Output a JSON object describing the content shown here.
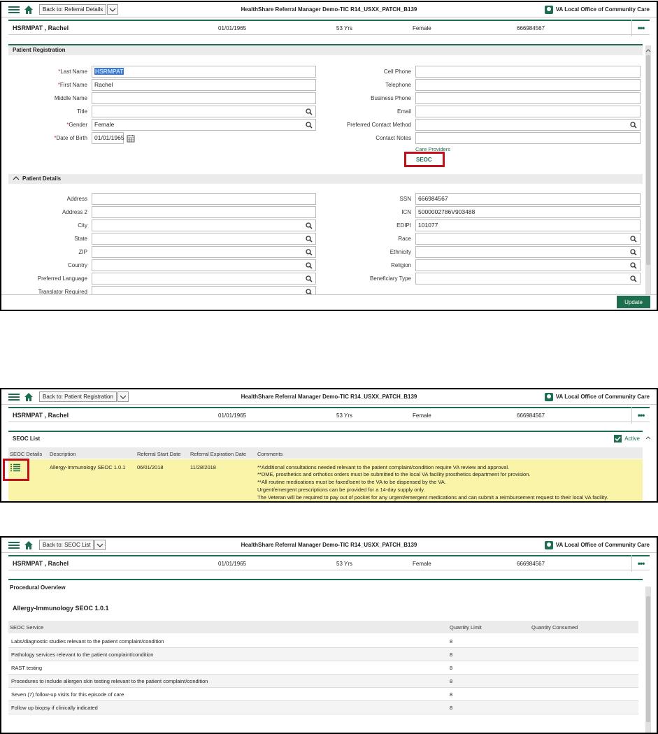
{
  "app_title": "HealthShare Referral Manager Demo-TIC R14_USXX_PATCH_B139",
  "office": "VA Local Office of Community Care",
  "patient": {
    "name": "HSRMPAT , Rachel",
    "dob": "01/01/1965",
    "age": "53 Yrs",
    "gender": "Female",
    "ssn": "666984567"
  },
  "screen1": {
    "back_label": "Back to: Referral Details",
    "section_title": "Patient Registration",
    "left_fields": [
      {
        "label": "Last Name",
        "value": "HSRMPAT",
        "required": true
      },
      {
        "label": "First Name",
        "value": "Rachel",
        "required": true
      },
      {
        "label": "Middle Name",
        "value": ""
      },
      {
        "label": "Title",
        "value": ""
      },
      {
        "label": "Gender",
        "value": "Female",
        "required": true
      },
      {
        "label": "Date of Birth",
        "value": "01/01/1965",
        "required": true
      }
    ],
    "right_fields": [
      {
        "label": "Cell Phone",
        "value": ""
      },
      {
        "label": "Telephone",
        "value": ""
      },
      {
        "label": "Business Phone",
        "value": ""
      },
      {
        "label": "Email",
        "value": ""
      },
      {
        "label": "Preferred Contact Method",
        "value": ""
      },
      {
        "label": "Contact Notes",
        "value": ""
      }
    ],
    "care_providers_link": "Care Providers",
    "seoc_link": "SEOC",
    "details_title": "Patient Details",
    "details_left": [
      {
        "label": "Address",
        "value": ""
      },
      {
        "label": "Address 2",
        "value": ""
      },
      {
        "label": "City",
        "value": ""
      },
      {
        "label": "State",
        "value": ""
      },
      {
        "label": "ZIP",
        "value": ""
      },
      {
        "label": "Country",
        "value": ""
      },
      {
        "label": "Preferred Language",
        "value": ""
      },
      {
        "label": "Translator Required",
        "value": ""
      }
    ],
    "details_right": [
      {
        "label": "SSN",
        "value": "666984567"
      },
      {
        "label": "ICN",
        "value": "5000002786V903488"
      },
      {
        "label": "EDIPI",
        "value": "101077"
      },
      {
        "label": "Race",
        "value": ""
      },
      {
        "label": "Ethnicity",
        "value": ""
      },
      {
        "label": "Religion",
        "value": ""
      },
      {
        "label": "Beneficiary Type",
        "value": ""
      }
    ],
    "update_label": "Update"
  },
  "screen2": {
    "back_label": "Back to: Patient Registration",
    "section_title": "SEOC List",
    "active_label": "Active",
    "columns": [
      "SEOC Details",
      "Description",
      "Referral Start Date",
      "Referral Expiration Date",
      "Comments"
    ],
    "row": {
      "description": "Allergy-Immunology SEOC 1.0.1",
      "start": "06/01/2018",
      "expiration": "11/28/2018",
      "comments": [
        "**Additional consultations needed relevant to the patient complaint/condition require VA review and approval.",
        "**DME, prosthetics and orthotics orders must be submitted to the local VA facility prosthetics department for provision.",
        "**All routine medications must be faxed\\sent to the VA to be dispensed by the VA.",
        "Urgent/emergent prescriptions can be provided for a 14-day supply only.",
        "The Veteran will be required to pay out of pocket for any urgent/emergent medications and  can submit a reimbursement request to their local VA facility."
      ]
    }
  },
  "screen3": {
    "back_label": "Back to: SEOC List",
    "section_title": "Procedural Overview",
    "seoc_title": "Allergy-Immunology SEOC 1.0.1",
    "columns": [
      "SEOC Service",
      "Quantity Limit",
      "Quantity Consumed"
    ],
    "services": [
      {
        "service": "Labs/diagnostic studies relevant to the patient complaint/condition",
        "limit": "8"
      },
      {
        "service": "Pathology services relevant to the patient complaint/condition",
        "limit": "8"
      },
      {
        "service": "RAST testing",
        "limit": "8"
      },
      {
        "service": "Procedures to include allergen skin testing relevant to the patient complaint/condition",
        "limit": "8"
      },
      {
        "service": "Seven (7) follow-up visits for this episode of care",
        "limit": "8"
      },
      {
        "service": "Follow up biopsy if clinically indicated",
        "limit": "8"
      }
    ]
  }
}
